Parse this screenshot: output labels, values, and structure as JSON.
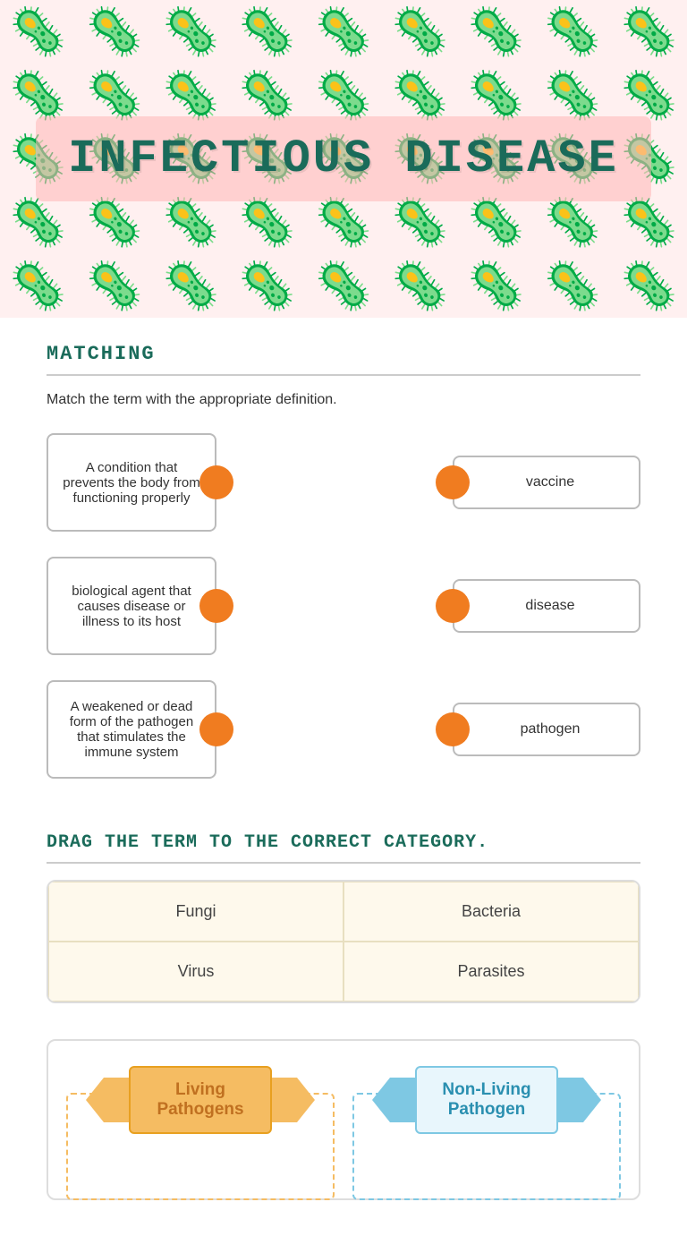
{
  "hero": {
    "title": "INFECTIOUS DISEASE"
  },
  "matching": {
    "section_label": "MATCHING",
    "instructions": "Match the term with the appropriate definition.",
    "pairs": [
      {
        "definition": "A condition that prevents the body from functioning properly",
        "term": "vaccine"
      },
      {
        "definition": "biological agent that causes disease or illness to its host",
        "term": "disease"
      },
      {
        "definition": "A weakened or dead form of the pathogen that stimulates the immune system",
        "term": "pathogen"
      }
    ]
  },
  "drag_section": {
    "label": "DRAG THE TERM TO THE CORRECT CATEGORY.",
    "cells": [
      "Fungi",
      "Bacteria",
      "Virus",
      "Parasites"
    ]
  },
  "categories": {
    "living": "Living\nPathogens",
    "nonliving": "Non-Living\nPathogen"
  }
}
